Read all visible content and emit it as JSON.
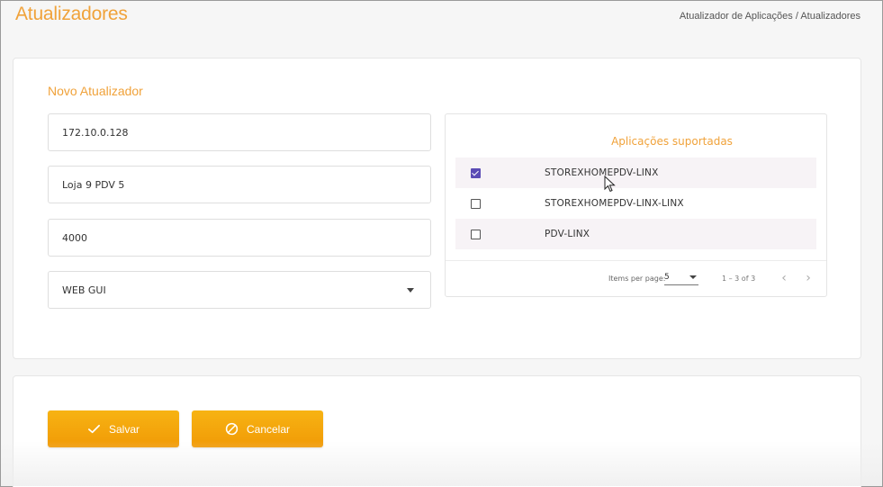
{
  "header": {
    "title": "Atualizadores",
    "breadcrumb": "Atualizador de Aplicações / Atualizadores"
  },
  "form": {
    "section_title": "Novo Atualizador",
    "fields": [
      {
        "value": "172.10.0.128"
      },
      {
        "value": "Loja 9 PDV 5"
      },
      {
        "value": "4000"
      }
    ],
    "select": {
      "value": "WEB GUI",
      "icon": "chevron-down-icon"
    }
  },
  "apps": {
    "title": "Aplicações suportadas",
    "rows": [
      {
        "name": "STOREXHOMEPDV-LINX",
        "checked": true
      },
      {
        "name": "STOREXHOMEPDV-LINX-LINX",
        "checked": false
      },
      {
        "name": "PDV-LINX",
        "checked": false
      }
    ],
    "paginator": {
      "items_per_page_label": "Items per page:",
      "page_size": "5",
      "range_label": "1 – 3 of 3",
      "prev_icon": "chevron-left-icon",
      "next_icon": "chevron-right-icon"
    }
  },
  "actions": {
    "save_label": "Salvar",
    "cancel_label": "Cancelar",
    "save_icon": "check-icon",
    "cancel_icon": "cancel-icon"
  },
  "colors": {
    "accent": "#f0a23a",
    "button": "#f5a70c",
    "checkbox": "#5b4bb5"
  }
}
